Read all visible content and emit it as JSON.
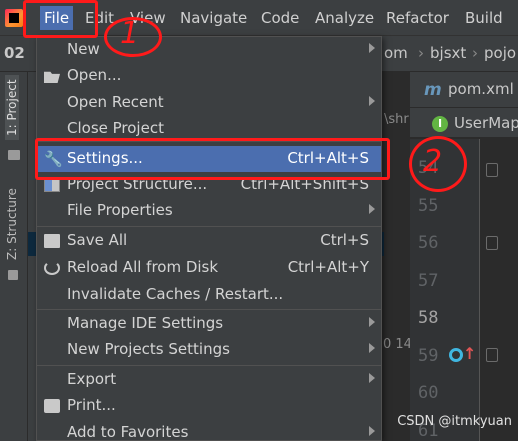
{
  "menubar": {
    "items": [
      "File",
      "Edit",
      "View",
      "Navigate",
      "Code",
      "Analyze",
      "Refactor",
      "Build"
    ]
  },
  "breadcrumb": {
    "prefix": "02",
    "items": [
      "om",
      "bjsxt",
      "pojo"
    ]
  },
  "tool_strip": {
    "project_tab": "1: Project",
    "structure_tab": "Z: Structure"
  },
  "behind": {
    "shr_text": "\\shr",
    "time_text": "0 14:"
  },
  "editor": {
    "tabs": [
      "pom.xml",
      "UserMap"
    ],
    "line_numbers": [
      "54",
      "55",
      "56",
      "57",
      "58",
      "59",
      "60",
      "61"
    ]
  },
  "file_menu": {
    "items": [
      {
        "label": "New",
        "shortcut": "",
        "submenu": true,
        "icon": ""
      },
      {
        "label": "Open...",
        "shortcut": "",
        "submenu": false,
        "icon": "folder-open-icon"
      },
      {
        "label": "Open Recent",
        "shortcut": "",
        "submenu": true,
        "icon": ""
      },
      {
        "label": "Close Project",
        "shortcut": "",
        "submenu": false,
        "icon": ""
      },
      {
        "label": "Settings...",
        "shortcut": "Ctrl+Alt+S",
        "submenu": false,
        "icon": "wrench-icon",
        "highlighted": true
      },
      {
        "label": "Project Structure...",
        "shortcut": "Ctrl+Alt+Shift+S",
        "submenu": false,
        "icon": "project-structure-icon"
      },
      {
        "label": "File Properties",
        "shortcut": "",
        "submenu": true,
        "icon": ""
      },
      {
        "label": "Save All",
        "shortcut": "Ctrl+S",
        "submenu": false,
        "icon": "save-icon"
      },
      {
        "label": "Reload All from Disk",
        "shortcut": "Ctrl+Alt+Y",
        "submenu": false,
        "icon": "reload-icon"
      },
      {
        "label": "Invalidate Caches / Restart...",
        "shortcut": "",
        "submenu": false,
        "icon": ""
      },
      {
        "label": "Manage IDE Settings",
        "shortcut": "",
        "submenu": true,
        "icon": ""
      },
      {
        "label": "New Projects Settings",
        "shortcut": "",
        "submenu": true,
        "icon": ""
      },
      {
        "label": "Export",
        "shortcut": "",
        "submenu": true,
        "icon": ""
      },
      {
        "label": "Print...",
        "shortcut": "",
        "submenu": false,
        "icon": "print-icon"
      },
      {
        "label": "Add to Favorites",
        "shortcut": "",
        "submenu": true,
        "icon": ""
      }
    ]
  },
  "annotations": {
    "step1": "1",
    "step2": "2",
    "color": "#ff1a1a"
  },
  "watermark": "CSDN @itmkyuan",
  "colors": {
    "menu_bg": "#3c3f41",
    "highlight": "#4b6eaf",
    "editor_bg": "#2b2b2b"
  }
}
